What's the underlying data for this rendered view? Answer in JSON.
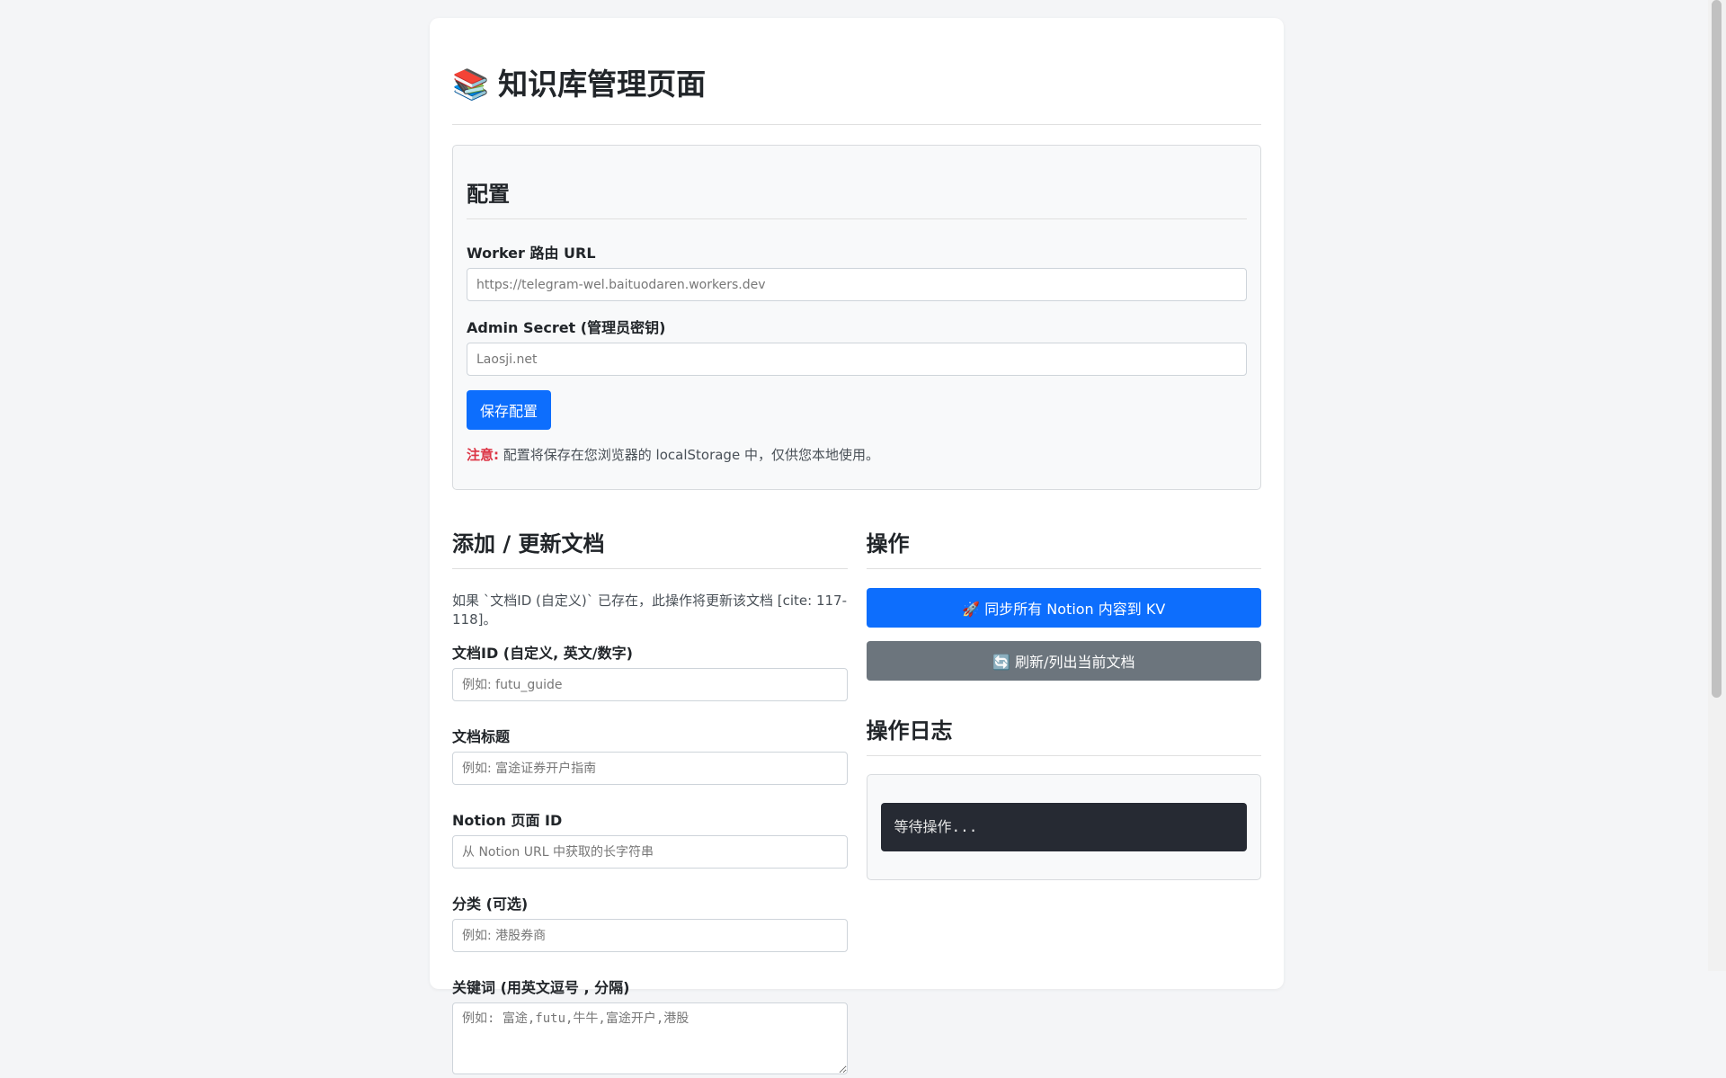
{
  "page": {
    "icon": "books-icon",
    "icon_glyph": "📚",
    "title": "知识库管理页面"
  },
  "config": {
    "heading": "配置",
    "worker_url_label": "Worker 路由 URL",
    "worker_url_value": "https://telegram-wel.baituodaren.workers.dev",
    "admin_secret_label": "Admin Secret (管理员密钥)",
    "admin_secret_value": "Laosji.net",
    "save_button": "保存配置",
    "note_strong": "注意:",
    "note_text": " 配置将保存在您浏览器的 localStorage 中，仅供您本地使用。"
  },
  "doc_form": {
    "heading": "添加 / 更新文档",
    "description": "如果 `文档ID (自定义)` 已存在，此操作将更新该文档 [cite: 117-118]。",
    "doc_id_label": "文档ID (自定义, 英文/数字)",
    "doc_id_placeholder": "例如: futu_guide",
    "doc_title_label": "文档标题",
    "doc_title_placeholder": "例如: 富途证券开户指南",
    "notion_id_label": "Notion 页面 ID",
    "notion_id_placeholder": "从 Notion URL 中获取的长字符串",
    "category_label": "分类 (可选)",
    "category_placeholder": "例如: 港股券商",
    "keywords_label": "关键词 (用英文逗号 , 分隔)",
    "keywords_placeholder": "例如: 富途,futu,牛牛,富途开户,港股"
  },
  "actions": {
    "heading": "操作",
    "sync_button": "🚀 同步所有 Notion 内容到 KV",
    "refresh_button": "🔄 刷新/列出当前文档",
    "log_heading": "操作日志",
    "log_text": "等待操作..."
  },
  "colors": {
    "primary": "#0d6efd",
    "secondary": "#6c757d",
    "danger": "#dc3545",
    "log_bg": "#262a33"
  }
}
